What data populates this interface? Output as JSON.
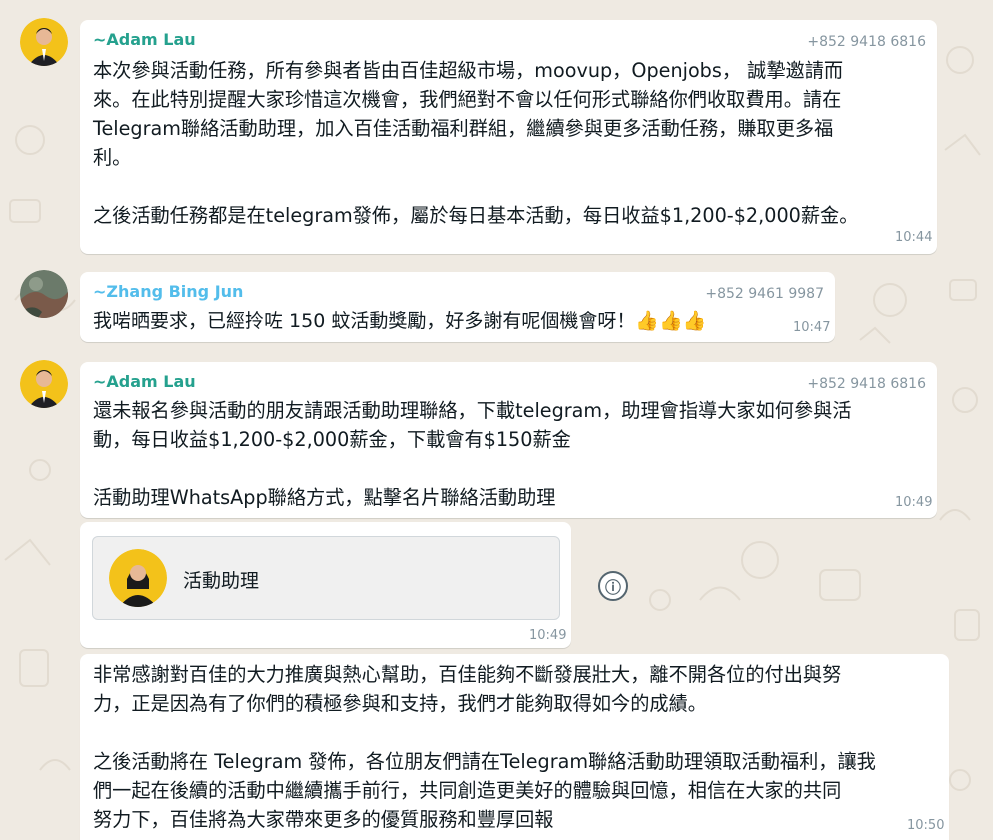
{
  "messages": [
    {
      "sender": "~Adam Lau",
      "phone": "+852 9418 6816",
      "text": "本次參與活動任務，所有參與者皆由百佳超級市場，moovup，Openjobs， 誠摯邀請而\n來。在此特別提醒大家珍惜這次機會，我們絕對不會以任何形式聯絡你們收取費用。請在\nTelegram聯絡活動助理，加入百佳活動福利群組，繼續參與更多活動任務，賺取更多福\n利。\n\n之後活動任務都是在telegram發佈，屬於每日基本活動，每日收益$1,200-$2,000薪金。",
      "time": "10:44"
    },
    {
      "sender": "~Zhang Bing Jun",
      "phone": "+852 9461 9987",
      "text": "我啱晒要求，已經拎咗 150 蚊活動獎勵，好多謝有呢個機會呀！👍👍👍",
      "time": "10:47"
    },
    {
      "sender": "~Adam Lau",
      "phone": "+852 9418 6816",
      "text": "還未報名參與活動的朋友請跟活動助理聯絡，下載telegram，助理會指導大家如何參與活\n動，每日收益$1,200-$2,000薪金，下載會有$150薪金\n\n活動助理WhatsApp聯絡方式，點擊名片聯絡活動助理",
      "time": "10:49"
    },
    {
      "contact_name": "活動助理",
      "time": "10:49"
    },
    {
      "text": "非常感謝對百佳的大力推廣與熱心幫助，百佳能夠不斷發展壯大，離不開各位的付出與努\n力，正是因為有了你們的積極參與和支持，我們才能夠取得如今的成績。\n\n之後活動將在 Telegram 發佈，各位朋友們請在Telegram聯絡活動助理領取活動福利，讓我\n們一起在後續的活動中繼續攜手前行，共同創造更美好的體驗與回憶，相信在大家的共同\n努力下，百佳將為大家帶來更多的優質服務和豐厚回報",
      "time": "10:50"
    }
  ],
  "info_icon": "ⓘ",
  "colors": {
    "background": "#efeae2",
    "sender_adam": "#25a18e",
    "sender_zhang": "#53bdeb",
    "phone": "#8696a0"
  }
}
